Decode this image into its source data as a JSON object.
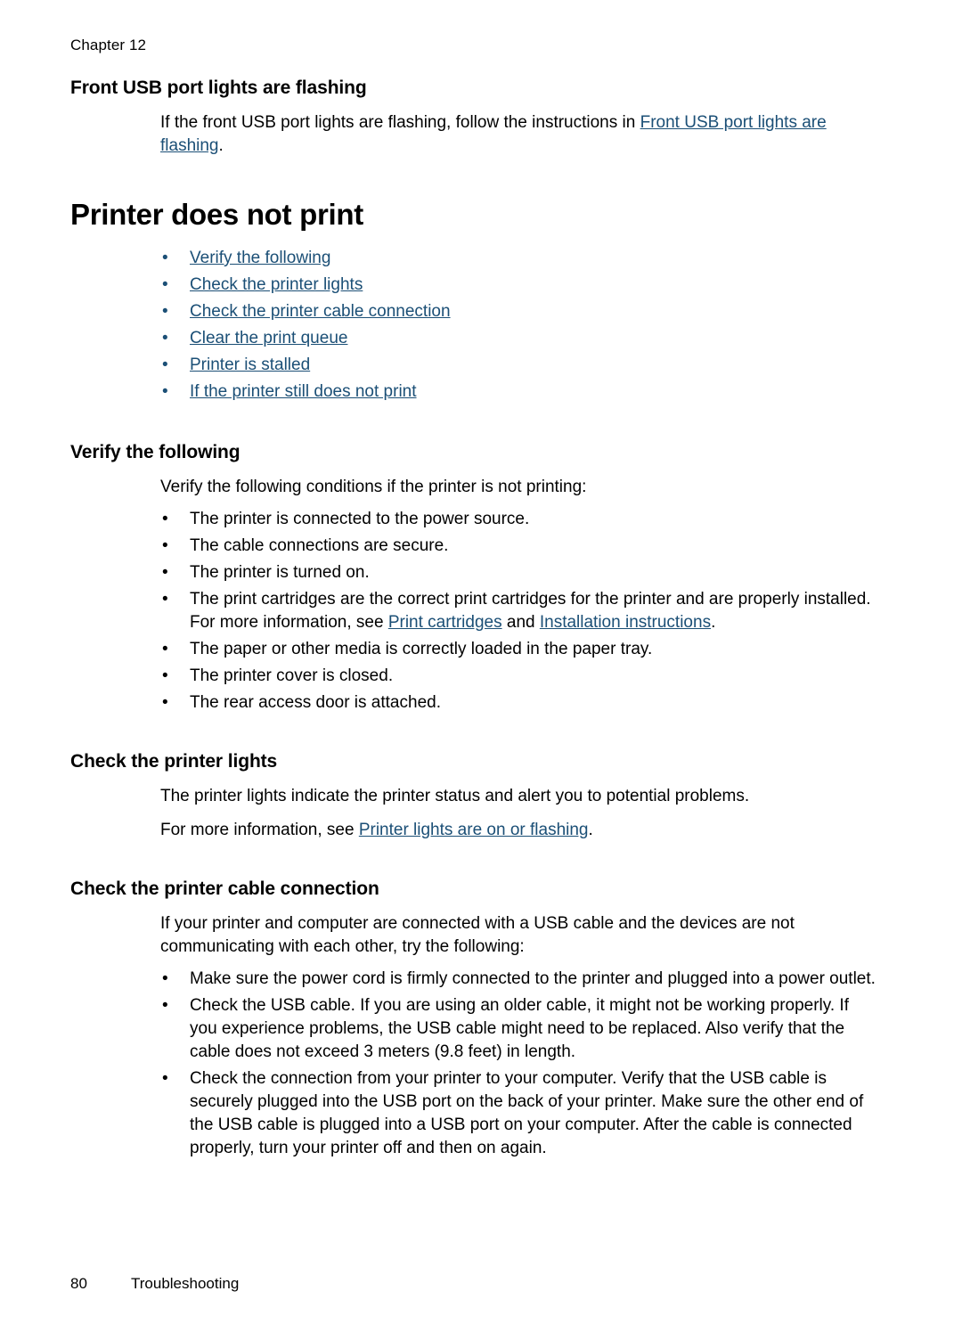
{
  "header": {
    "chapter": "Chapter 12"
  },
  "sections": {
    "front_usb": {
      "title": "Front USB port lights are flashing",
      "body_prefix": "If the front USB port lights are flashing, follow the instructions in ",
      "body_link": "Front USB port lights are flashing",
      "body_suffix": "."
    },
    "printer_does_not_print": {
      "title": "Printer does not print",
      "links": [
        "Verify the following",
        "Check the printer lights",
        "Check the printer cable connection",
        "Clear the print queue",
        "Printer is stalled",
        "If the printer still does not print"
      ],
      "bullet_glyph": "•"
    },
    "verify_the_following": {
      "title": "Verify the following",
      "intro": "Verify the following conditions if the printer is not printing:",
      "items": [
        "The printer is connected to the power source.",
        "The cable connections are secure.",
        "The printer is turned on."
      ],
      "cartridges_item": {
        "text": "The print cartridges are the correct print cartridges for the printer and are properly installed.",
        "more_info_prefix": "For more information, see ",
        "link_1": "Print cartridges",
        "more_info_mid": " and ",
        "link_2": "Installation instructions",
        "more_info_suffix": "."
      },
      "items_after": [
        "The paper or other media is correctly loaded in the paper tray.",
        "The printer cover is closed.",
        "The rear access door is attached."
      ]
    },
    "check_printer_lights": {
      "title": "Check the printer lights",
      "para_1": "The printer lights indicate the printer status and alert you to potential problems.",
      "para_2_prefix": "For more information, see ",
      "para_2_link": "Printer lights are on or flashing",
      "para_2_suffix": "."
    },
    "check_cable_connection": {
      "title": "Check the printer cable connection",
      "intro": "If your printer and computer are connected with a USB cable and the devices are not communicating with each other, try the following:",
      "items": [
        "Make sure the power cord is firmly connected to the printer and plugged into a power outlet.",
        "Check the USB cable. If you are using an older cable, it might not be working properly. If you experience problems, the USB cable might need to be replaced. Also verify that the cable does not exceed 3 meters (9.8 feet) in length.",
        "Check the connection from your printer to your computer. Verify that the USB cable is securely plugged into the USB port on the back of your printer. Make sure the other end of the USB cable is plugged into a USB port on your computer. After the cable is connected properly, turn your printer off and then on again."
      ]
    }
  },
  "footer": {
    "page_number": "80",
    "label": "Troubleshooting"
  },
  "colors": {
    "link": "#1b4f76",
    "text": "#000000",
    "background": "#ffffff"
  }
}
